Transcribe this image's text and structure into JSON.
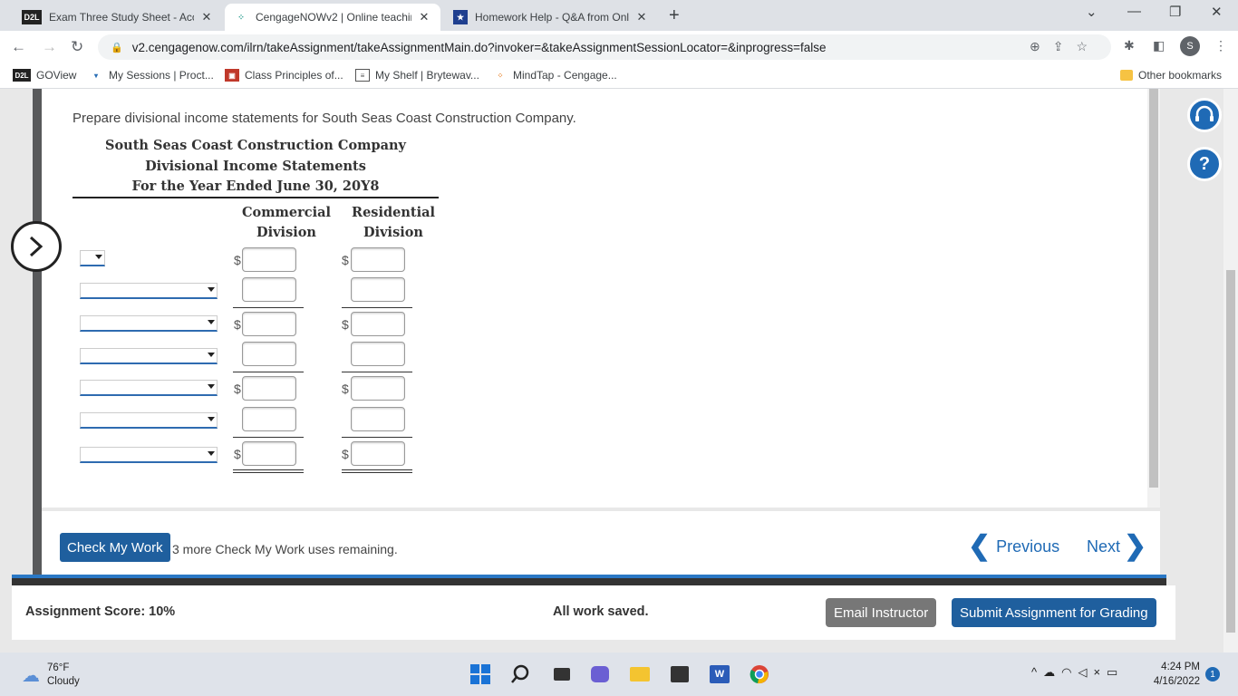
{
  "browser": {
    "tabs": [
      {
        "favicon": "D2L",
        "title": "Exam Three Study Sheet - Accoun",
        "active": false
      },
      {
        "favicon": "cengage-icon",
        "title": "CengageNOWv2 | Online teachin",
        "active": true
      },
      {
        "favicon": "star-icon",
        "title": "Homework Help - Q&A from Onl",
        "active": false
      }
    ],
    "url": "v2.cengagenow.com/ilrn/takeAssignment/takeAssignmentMain.do?invoker=&takeAssignmentSessionLocator=&inprogress=false",
    "avatar_letter": "S",
    "bookmarks": [
      {
        "icon": "D2L",
        "label": "GOView"
      },
      {
        "icon": "shield-icon",
        "label": "My Sessions | Proct..."
      },
      {
        "icon": "book-icon",
        "label": "Class Principles of..."
      },
      {
        "icon": "shelf-icon",
        "label": "My Shelf | Brytewav..."
      },
      {
        "icon": "cengage-icon",
        "label": "MindTap - Cengage..."
      }
    ],
    "other_bookmarks": "Other bookmarks"
  },
  "assignment": {
    "prompt": "Prepare divisional income statements for South Seas Coast Construction Company.",
    "company": "South Seas Coast Construction Company",
    "statement_title": "Divisional Income Statements",
    "period": "For the Year Ended June 30, 20Y8",
    "col1_line1": "Commercial",
    "col1_line2": "Division",
    "col2_line1": "Residential",
    "col2_line2": "Division",
    "currency_symbol": "$"
  },
  "footer": {
    "check_my_work": "Check My Work",
    "remaining": "3 more Check My Work uses remaining.",
    "previous": "Previous",
    "next": "Next"
  },
  "status": {
    "score": "Assignment Score: 10%",
    "saved": "All work saved.",
    "email": "Email Instructor",
    "submit": "Submit Assignment for Grading"
  },
  "taskbar": {
    "temp": "76°F",
    "condition": "Cloudy",
    "time": "4:24 PM",
    "date": "4/16/2022",
    "notifications": "1"
  }
}
